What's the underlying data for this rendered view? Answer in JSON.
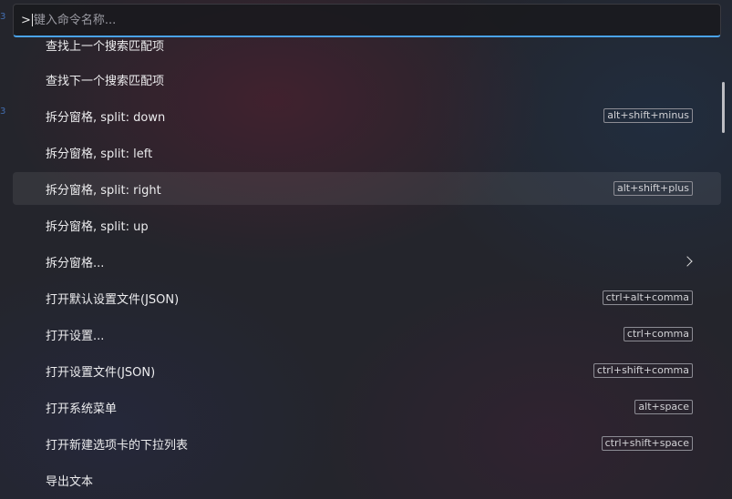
{
  "search": {
    "prompt": ">",
    "placeholder": "键入命令名称..."
  },
  "commands": [
    {
      "label": "查找上一个搜索匹配项",
      "shortcut": ""
    },
    {
      "label": "查找下一个搜索匹配项",
      "shortcut": ""
    },
    {
      "label": "拆分窗格, split: down",
      "shortcut": "alt+shift+minus"
    },
    {
      "label": "拆分窗格, split: left",
      "shortcut": ""
    },
    {
      "label": "拆分窗格, split: right",
      "shortcut": "alt+shift+plus"
    },
    {
      "label": "拆分窗格, split: up",
      "shortcut": ""
    },
    {
      "label": "拆分窗格...",
      "shortcut": ""
    },
    {
      "label": "打开默认设置文件(JSON)",
      "shortcut": "ctrl+alt+comma"
    },
    {
      "label": "打开设置...",
      "shortcut": "ctrl+comma"
    },
    {
      "label": "打开设置文件(JSON)",
      "shortcut": "ctrl+shift+comma"
    },
    {
      "label": "打开系统菜单",
      "shortcut": "alt+space"
    },
    {
      "label": "打开新建选项卡的下拉列表",
      "shortcut": "ctrl+shift+space"
    },
    {
      "label": "导出文本",
      "shortcut": ""
    }
  ],
  "selected_index": 4,
  "icons": {
    "submenu": "chevron-right-icon"
  }
}
